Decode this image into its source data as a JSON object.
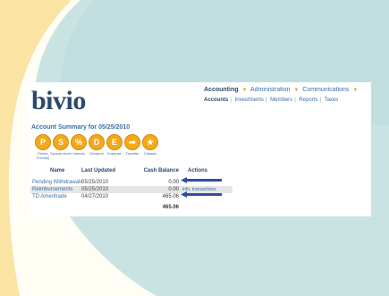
{
  "colors": {
    "accent": "#f2a91a",
    "brand": "#2a4a6b",
    "link": "#3a6fa8",
    "arrow": "#2f4fa0"
  },
  "logo": {
    "text": "bivio"
  },
  "topnav": {
    "items": [
      {
        "label": "Accounting",
        "active": true
      },
      {
        "label": "Administration",
        "active": false
      },
      {
        "label": "Communications",
        "active": false
      }
    ]
  },
  "subnav": {
    "items": [
      "Accounts",
      "Investments",
      "Members",
      "Reports",
      "Taxes"
    ]
  },
  "summary": {
    "title": "Account Summary for 05/25/2010"
  },
  "actions": [
    {
      "letter": "P",
      "label": "Printer Friendly",
      "icon": "printer-icon"
    },
    {
      "letter": "S",
      "label": "Spread sheet",
      "icon": "spreadsheet-icon"
    },
    {
      "letter": "%",
      "label": "Interest",
      "icon": "percent-icon"
    },
    {
      "letter": "D",
      "label": "Dividend",
      "icon": "dividend-icon"
    },
    {
      "letter": "E",
      "label": "Expense",
      "icon": "expense-icon"
    },
    {
      "letter": "➡",
      "label": "Transfer",
      "icon": "arrow-right-icon"
    },
    {
      "letter": "★",
      "label": "Classes",
      "icon": "star-icon"
    }
  ],
  "table": {
    "headers": {
      "name": "Name",
      "updated": "Last Updated",
      "balance": "Cash Balance",
      "actions": "Actions"
    },
    "rows": [
      {
        "name": "Pending Withdrawals",
        "updated": "05/25/2010",
        "balance": "0.00",
        "action": ""
      },
      {
        "name": "Reimbursements",
        "updated": "05/25/2010",
        "balance": "0.00",
        "action": "info, transactions"
      },
      {
        "name": "TD Ameritrade",
        "updated": "04/27/2010",
        "balance": "465.06",
        "action": ""
      }
    ],
    "total": "465.06"
  }
}
